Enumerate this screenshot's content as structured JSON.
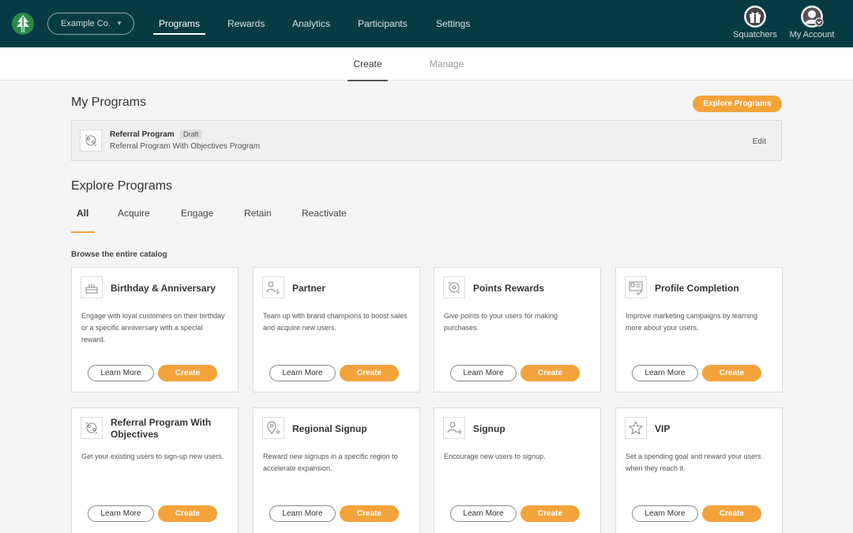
{
  "header": {
    "org_name": "Example Co.",
    "nav": [
      "Programs",
      "Rewards",
      "Analytics",
      "Participants",
      "Settings"
    ],
    "active_nav": "Programs",
    "right_buttons": [
      {
        "label": "Squatchers",
        "icon": "gift-icon"
      },
      {
        "label": "My Account",
        "icon": "account-icon"
      }
    ],
    "brand_color": "#073b44",
    "accent_color": "#f3a33b"
  },
  "subtabs": [
    "Create",
    "Manage"
  ],
  "active_subtab": "Create",
  "my_programs": {
    "title": "My Programs",
    "explore_button": "Explore Programs",
    "items": [
      {
        "name": "Referral Program",
        "status": "Draft",
        "description": "Referral Program With Objectives Program",
        "action": "Edit"
      }
    ]
  },
  "explore": {
    "title": "Explore Programs",
    "tabs": [
      "All",
      "Acquire",
      "Engage",
      "Retain",
      "Reactivate"
    ],
    "active_tab": "All",
    "browse_label": "Browse the entire catalog",
    "learn_more_label": "Learn More",
    "create_label": "Create",
    "cards": [
      {
        "title": "Birthday & Anniversary",
        "description": "Engage with loyal customers on their birthday or a specific anniversary with a special reward.",
        "icon": "cake-icon"
      },
      {
        "title": "Partner",
        "description": "Team up with brand champions to boost sales and acquire new users.",
        "icon": "partner-icon"
      },
      {
        "title": "Points Rewards",
        "description": "Give points to your users for making purchases.",
        "icon": "points-icon"
      },
      {
        "title": "Profile Completion",
        "description": "Improve marketing campaigns by learning more about your users.",
        "icon": "profile-card-icon"
      },
      {
        "title": "Referral Program With Objectives",
        "description": "Get your existing users to sign-up new users.",
        "icon": "referral-icon"
      },
      {
        "title": "Regional Signup",
        "description": "Reward new signups in a specific region to accelerate expansion.",
        "icon": "location-pin-icon"
      },
      {
        "title": "Signup",
        "description": "Encourage new users to signup.",
        "icon": "add-user-icon"
      },
      {
        "title": "VIP",
        "description": "Set a spending goal and reward your users when they reach it.",
        "icon": "star-icon"
      }
    ]
  }
}
